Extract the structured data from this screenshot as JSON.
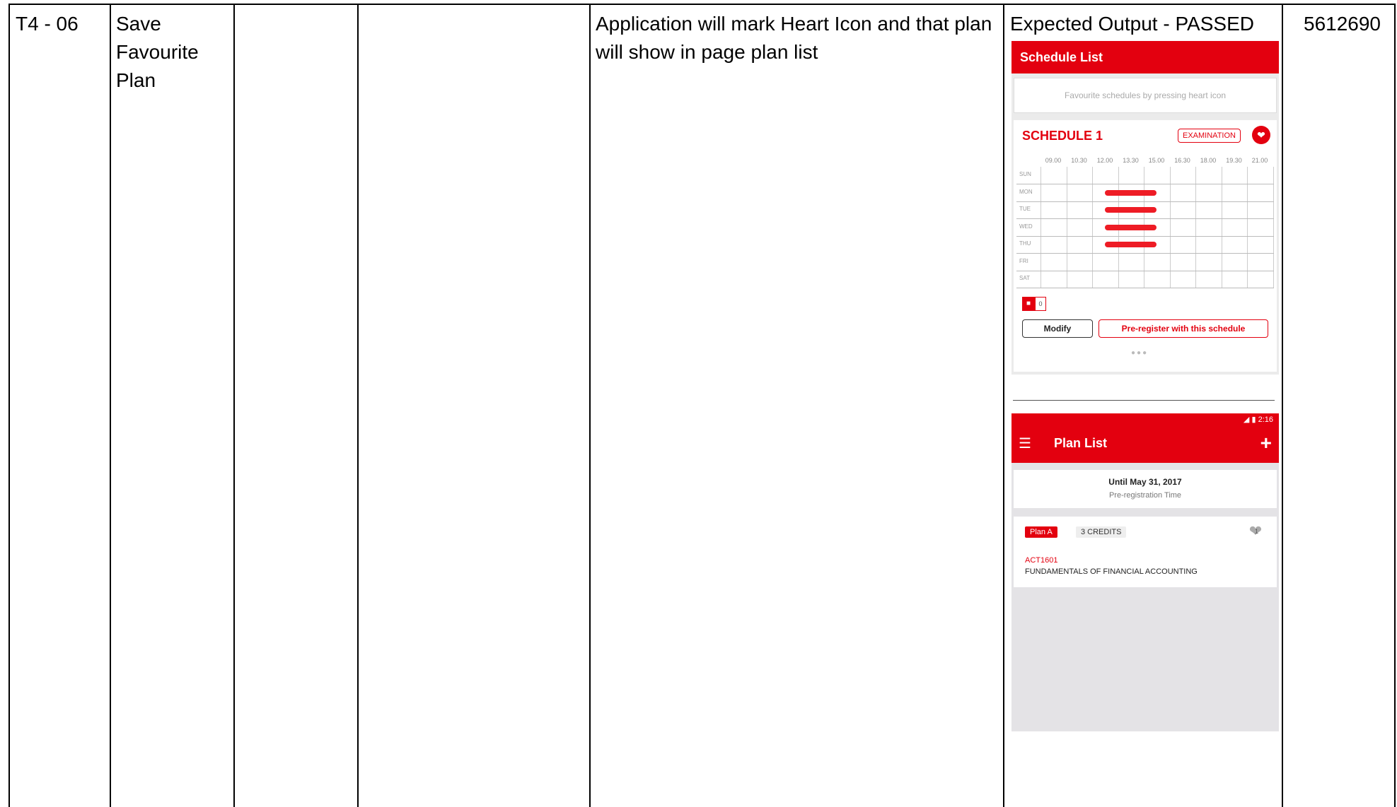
{
  "row": {
    "id": "T4 - 06",
    "name": "Save Favourite Plan",
    "col3": "",
    "col4": "",
    "description": "Application will mark Heart Icon and that plan will show in page plan list",
    "result": "Expected Output - PASSED",
    "student_id": "5612690"
  },
  "schedule_list": {
    "title": "Schedule List",
    "hint": "Favourite schedules by pressing heart icon",
    "card_title": "SCHEDULE 1",
    "badge": "EXAMINATION",
    "times": [
      "09.00",
      "10.30",
      "12.00",
      "13.30",
      "15.00",
      "16.30",
      "18.00",
      "19.30",
      "21.00"
    ],
    "days": [
      "SUN",
      "MON",
      "TUE",
      "WED",
      "THU",
      "FRI",
      "SAT"
    ],
    "booked_days": [
      "MON",
      "TUE",
      "WED",
      "THU"
    ],
    "booked_range": [
      "12.00",
      "15.00"
    ],
    "count": "0",
    "modify_label": "Modify",
    "preregister_label": "Pre-register with this schedule",
    "accent": "#e3000f"
  },
  "plan_list": {
    "status_time": "2:16",
    "title": "Plan List",
    "until_date": "Until May 31, 2017",
    "until_label": "Pre-registration Time",
    "plan_tag": "Plan A",
    "credits": "3 CREDITS",
    "heart_count": "1",
    "course_code": "ACT1601",
    "course_name": "FUNDAMENTALS OF FINANCIAL ACCOUNTING"
  }
}
